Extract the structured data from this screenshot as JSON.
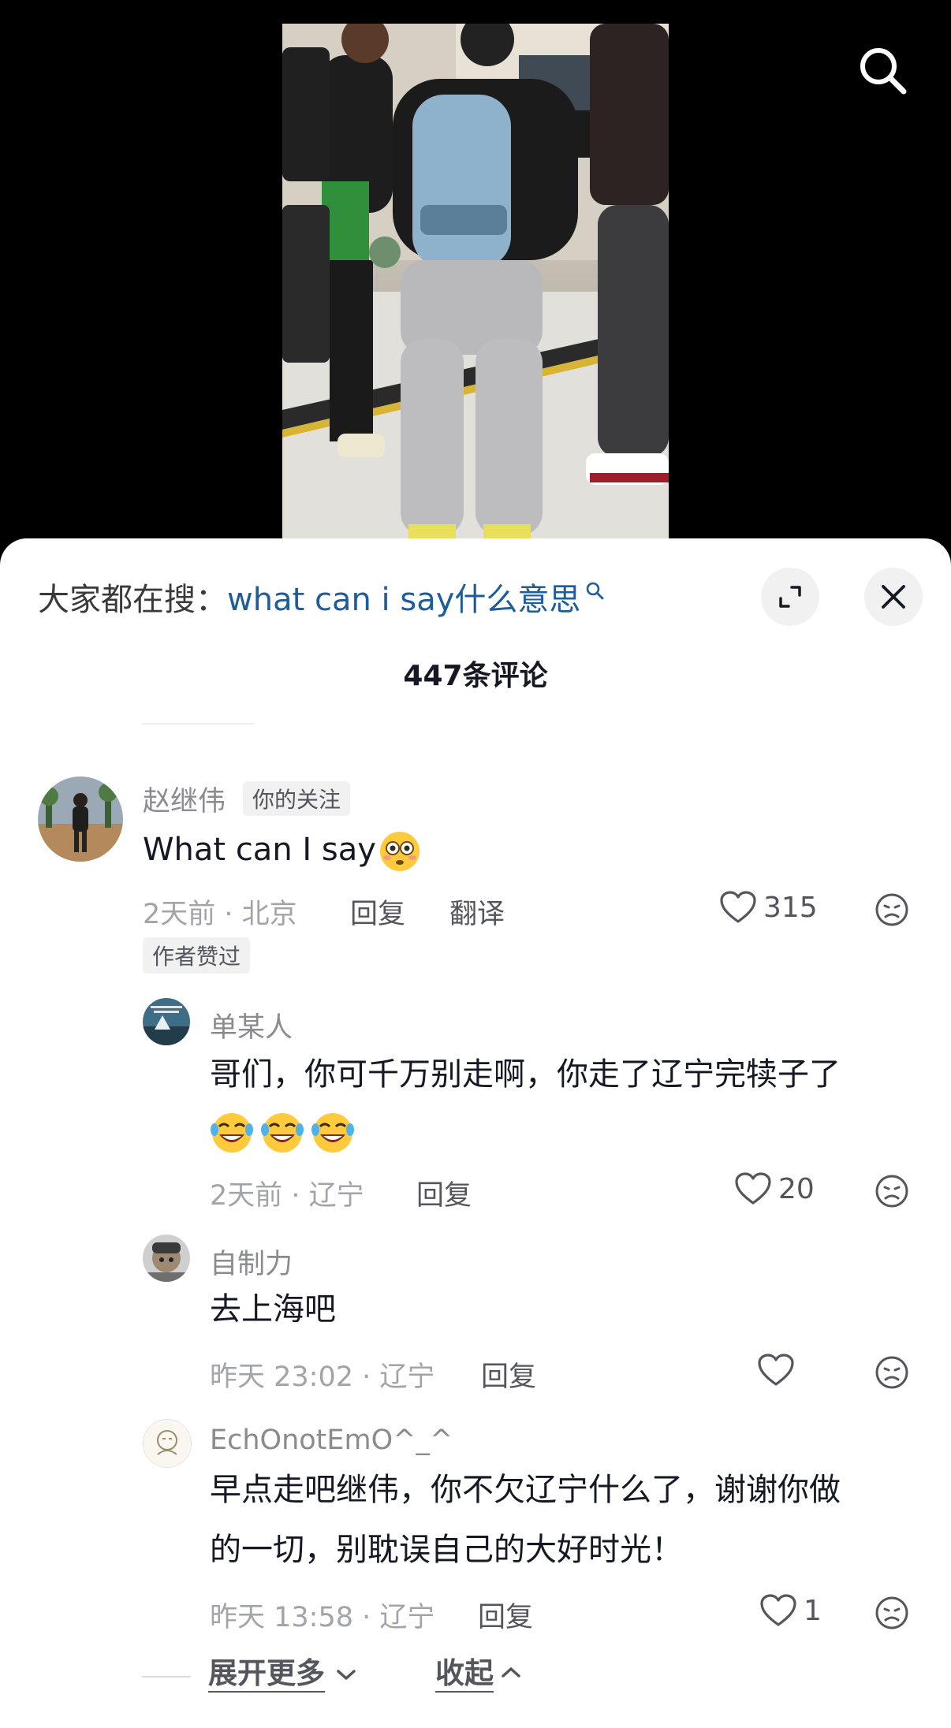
{
  "hot_search": {
    "prefix": "大家都在搜：",
    "term": "what can i say什么意思"
  },
  "comment_count": "447条评论",
  "comments": [
    {
      "name": "赵继伟",
      "follow_badge": "你的关注",
      "text": "What can I say",
      "emoji": "flushed-face",
      "meta": "2天前 · 北京",
      "reply": "回复",
      "translate": "翻译",
      "likes": "315",
      "author_badge": "作者赞过"
    },
    {
      "name": "单某人",
      "text": "哥们，你可千万别走啊，你走了辽宁完犊子了",
      "emoji": "rolling-on-floor-laughing x3",
      "meta": "2天前 · 辽宁",
      "reply": "回复",
      "likes": "20"
    },
    {
      "name": "自制力",
      "text": "去上海吧",
      "meta": "昨天 23:02 · 辽宁",
      "reply": "回复",
      "likes": ""
    },
    {
      "name": "EchOnotEmO^_^",
      "text_line1": "早点走吧继伟，你不欠辽宁什么了，谢谢你做",
      "text_line2": "的一切，别耽误自己的大好时光！",
      "meta": "昨天 13:58 · 辽宁",
      "reply": "回复",
      "likes": "1"
    }
  ],
  "footer": {
    "expand_more": "展开更多",
    "collapse": "收起"
  },
  "colors": {
    "search_term": "#1f5c9c",
    "muted": "#a3a4a9",
    "text": "#161823",
    "badge_bg": "#f1f1f2"
  },
  "icons": [
    "search-icon",
    "expand-icon",
    "close-icon",
    "heart-icon",
    "dislike-face-icon",
    "chevron-down-icon",
    "chevron-up-icon"
  ]
}
